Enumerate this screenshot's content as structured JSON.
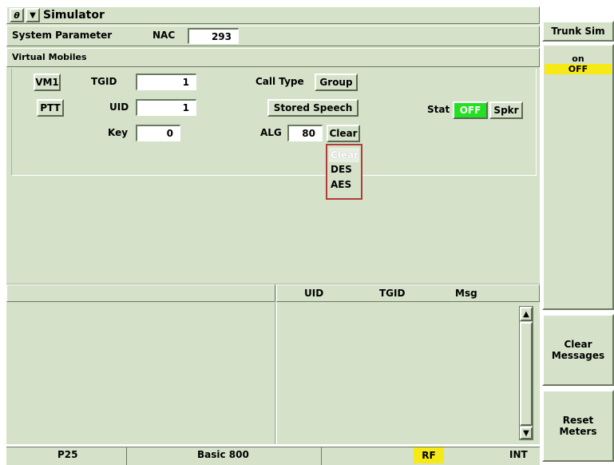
{
  "window": {
    "title": "Simulator",
    "icon_glyph": "θ",
    "menu_glyph": "▼"
  },
  "system": {
    "label": "System Parameter",
    "nac_label": "NAC",
    "nac_value": "293"
  },
  "virtual_mobiles": {
    "label": "Virtual Mobiles",
    "vm_button": "VM1",
    "ptt_button": "PTT",
    "tgid_label": "TGID",
    "tgid_value": "1",
    "uid_label": "UID",
    "uid_value": "1",
    "key_label": "Key",
    "key_value": "0",
    "call_type_label": "Call Type",
    "call_type_value": "Group",
    "stored_speech": "Stored Speech",
    "alg_label": "ALG",
    "alg_value": "80",
    "alg_selected": "Clear",
    "stat_label": "Stat",
    "stat_value": "OFF",
    "spkr_button": "Spkr"
  },
  "alg_dropdown": {
    "options": [
      "Clear",
      "DES",
      "AES"
    ]
  },
  "messages": {
    "columns": [
      "UID",
      "TGID",
      "Msg"
    ]
  },
  "status_bar": {
    "mode": "P25",
    "band": "Basic 800",
    "rf": "RF",
    "ref": "INT"
  },
  "softkeys": {
    "trunk_sim_label": "Trunk Sim",
    "trunk_on": "on",
    "trunk_off": "OFF",
    "clear_messages_line1": "Clear",
    "clear_messages_line2": "Messages",
    "reset_meters_line1": "Reset",
    "reset_meters_line2": "Meters"
  },
  "colors": {
    "panel": "#d5e2c9",
    "stat_green": "#22e022",
    "highlight_yellow": "#f6e916",
    "dropdown_border": "#b23a3a"
  }
}
